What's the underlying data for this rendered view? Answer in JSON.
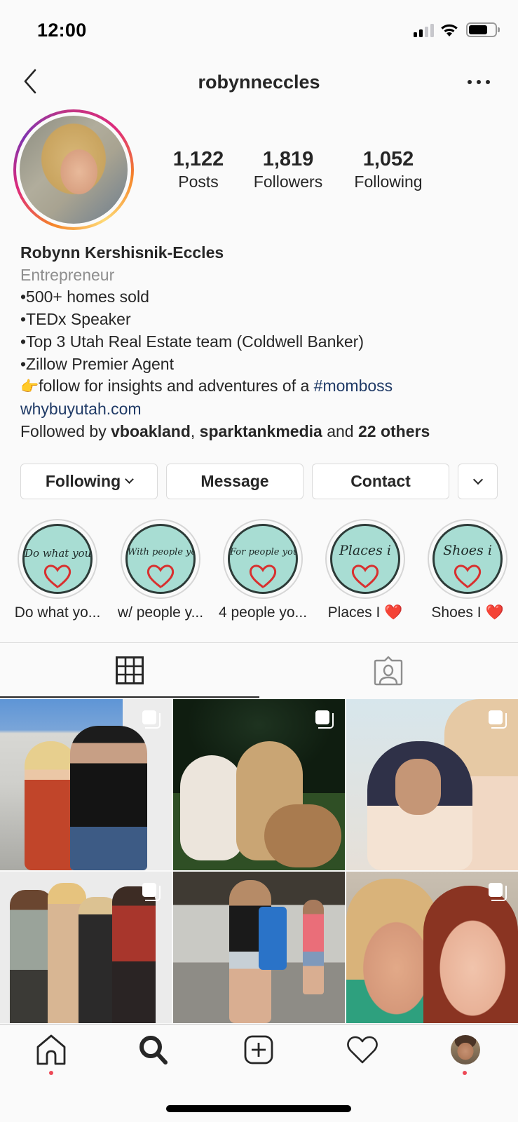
{
  "status_bar": {
    "time": "12:00",
    "icons": [
      "cellular-signal-icon",
      "wifi-icon",
      "battery-icon"
    ]
  },
  "header": {
    "username": "robynneccles",
    "back_icon": "chevron-left-icon",
    "more_icon": "more-horizontal-icon"
  },
  "profile": {
    "stats": [
      {
        "value": "1,122",
        "label": "Posts"
      },
      {
        "value": "1,819",
        "label": "Followers"
      },
      {
        "value": "1,052",
        "label": "Following"
      }
    ],
    "name": "Robynn Kershisnik-Eccles",
    "category": "Entrepreneur",
    "bio_lines": [
      "•500+ homes sold",
      "•TEDx Speaker",
      "•Top 3 Utah Real Estate team (Coldwell Banker)",
      "•Zillow Premier Agent"
    ],
    "bio_cta": {
      "emoji": "👉",
      "text": "follow for insights and adventures of a ",
      "hashtag": "#momboss"
    },
    "website": "whybuyutah.com",
    "followed_by": {
      "prefix": "Followed by ",
      "user1": "vboakland",
      "separator": ", ",
      "user2": "sparktankmedia",
      "middle": " and ",
      "others": "22 others"
    }
  },
  "actions": {
    "following_label": "Following",
    "message_label": "Message",
    "contact_label": "Contact",
    "more_icon": "chevron-down-icon"
  },
  "highlights": [
    {
      "cover_text": "Do what you",
      "label": "Do what yo..."
    },
    {
      "cover_text": "With people you",
      "label": "w/ people y..."
    },
    {
      "cover_text": "For people you",
      "label": "4 people yo..."
    },
    {
      "cover_text": "Places i",
      "label": "Places I ❤️"
    },
    {
      "cover_text": "Shoes i",
      "label": "Shoes I ❤️"
    }
  ],
  "tabs": [
    {
      "name": "grid",
      "icon": "grid-icon",
      "active": true
    },
    {
      "name": "tagged",
      "icon": "tagged-person-icon",
      "active": false
    }
  ],
  "posts": [
    {
      "description": "Woman in red dress with man in black cap",
      "multiple": true
    },
    {
      "description": "Three doodle and golden retriever dogs on grass",
      "multiple": true
    },
    {
      "description": "Two women selfie, one with glasses",
      "multiple": true
    },
    {
      "description": "Four people at Book of Mormon backdrop",
      "multiple": true
    },
    {
      "description": "Girl with blue tote bag on sidewalk",
      "multiple": false
    },
    {
      "description": "Two women smiling close-up selfie",
      "multiple": true
    }
  ],
  "bottom_nav": [
    {
      "name": "home",
      "icon": "home-icon",
      "notification_dot": true
    },
    {
      "name": "search",
      "icon": "search-icon",
      "notification_dot": false
    },
    {
      "name": "new-post",
      "icon": "add-post-icon",
      "notification_dot": false
    },
    {
      "name": "activity",
      "icon": "heart-icon",
      "notification_dot": false
    },
    {
      "name": "profile",
      "icon": "profile-avatar",
      "notification_dot": true
    }
  ],
  "colors": {
    "text": "#262626",
    "secondary_text": "#8e8e8e",
    "link": "#1f3a66",
    "notification": "#ed4956",
    "highlight_cover": "#a8ddd3",
    "heart": "#d8302f"
  }
}
